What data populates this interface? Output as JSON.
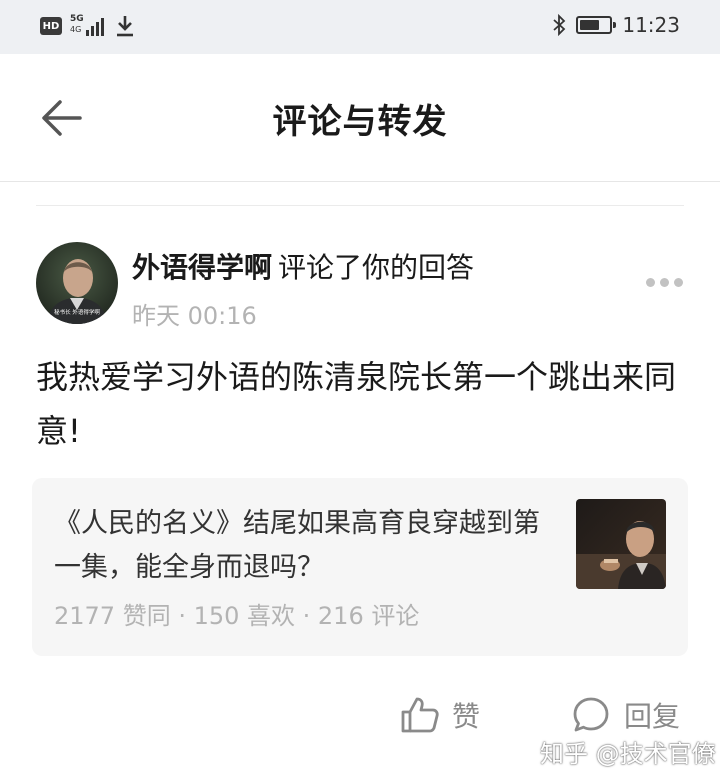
{
  "status_bar": {
    "hd_label": "HD",
    "network_label": "5G",
    "network_sub": "4G",
    "time": "11:23",
    "battery_level": 0.7,
    "icons": [
      "hd-icon",
      "signal-icon",
      "download-icon",
      "bluetooth-icon",
      "battery-icon"
    ]
  },
  "header": {
    "title": "评论与转发",
    "back_icon": "arrow-left-icon"
  },
  "comment": {
    "author": "外语得学啊",
    "action": "评论了你的回答",
    "time": "昨天 00:16",
    "text": "我热爱学习外语的陈清泉院长第一个跳出来同意!",
    "avatar_caption": "秘书长 外语得学啊"
  },
  "quoted_answer": {
    "title": "《人民的名义》结尾如果高育良穿越到第一集，能全身而退吗？",
    "meta": "2177 赞同 · 150 喜欢 · 216 评论"
  },
  "actions": {
    "like_label": "赞",
    "reply_label": "回复"
  },
  "watermark": "知乎 @技术官僚",
  "colors": {
    "status_bg": "#eef0f3",
    "card_bg": "#f6f6f6",
    "muted_text": "#b3b3b3",
    "action_gray": "#8a8a8a"
  }
}
